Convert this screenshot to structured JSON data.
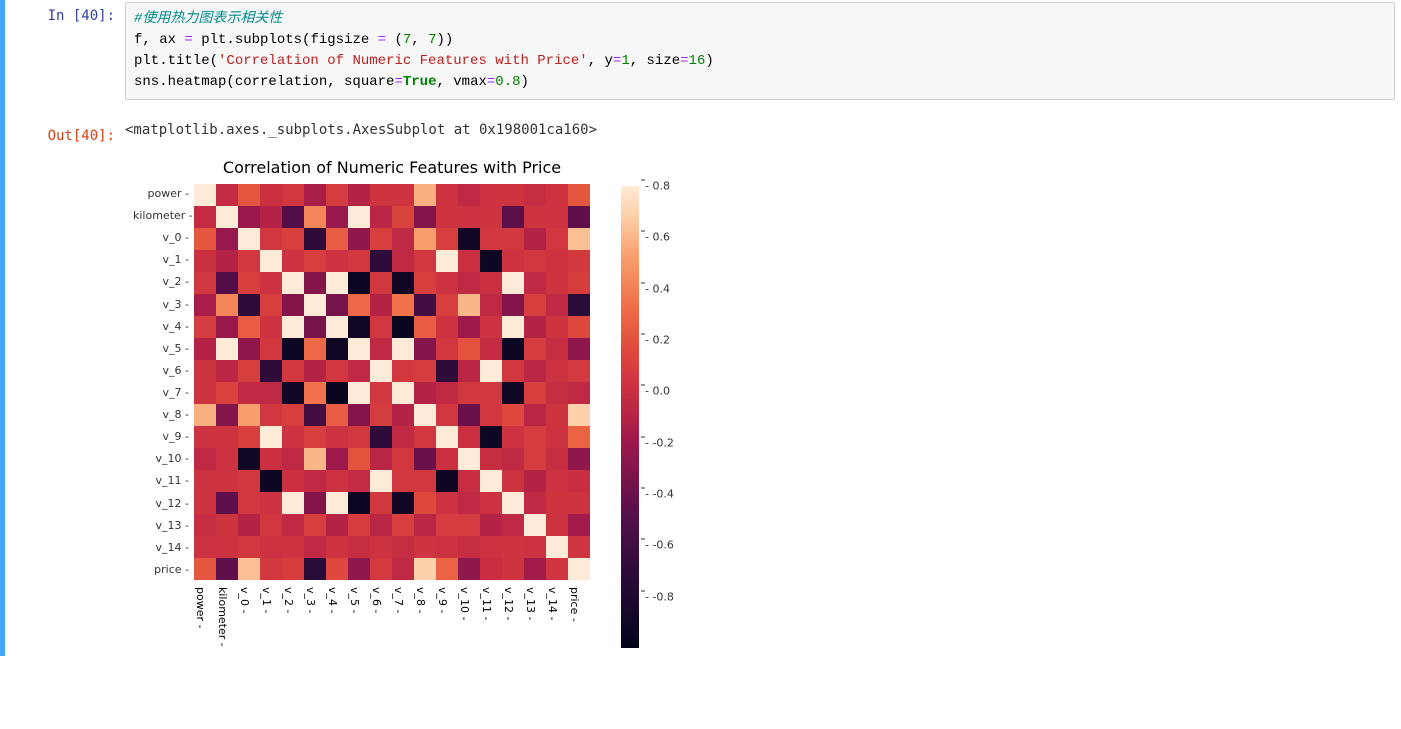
{
  "prompts": {
    "in_label": "In  [40]:",
    "out_label": "Out[40]:"
  },
  "code": {
    "line1_comment": "#使用热力图表示相关性",
    "line2_a": "f, ax ",
    "line2_eq": "=",
    "line2_b": " plt.subplots(figsize ",
    "line2_eq2": "=",
    "line2_c": " (",
    "line2_n1": "7",
    "line2_d": ", ",
    "line2_n2": "7",
    "line2_e": "))",
    "line3_a": "plt.title(",
    "line3_str": "'Correlation of Numeric Features with Price'",
    "line3_b": ", y",
    "line3_eq": "=",
    "line3_n1": "1",
    "line3_c": ", size",
    "line3_eq2": "=",
    "line3_n2": "16",
    "line3_d": ")",
    "line4_a": "sns.heatmap(correlation, square",
    "line4_eq": "=",
    "line4_true": "True",
    "line4_b": ", vmax",
    "line4_eq2": "=",
    "line4_n": "0.8",
    "line4_c": ")"
  },
  "output_text": "<matplotlib.axes._subplots.AxesSubplot at 0x198001ca160>",
  "chart_data": {
    "type": "heatmap",
    "title": "Correlation of Numeric Features with Price",
    "xlabel": "",
    "ylabel": "",
    "labels": [
      "power",
      "kilometer",
      "v_0",
      "v_1",
      "v_2",
      "v_3",
      "v_4",
      "v_5",
      "v_6",
      "v_7",
      "v_8",
      "v_9",
      "v_10",
      "v_11",
      "v_12",
      "v_13",
      "v_14",
      "price"
    ],
    "vmin": -1.0,
    "vmax": 0.8,
    "colorbar_ticks": [
      0.8,
      0.6,
      0.4,
      0.2,
      0.0,
      -0.2,
      -0.4,
      -0.6,
      -0.8
    ],
    "matrix": [
      [
        1.0,
        -0.03,
        0.22,
        0.01,
        0.05,
        -0.15,
        0.08,
        -0.1,
        0.03,
        0.03,
        0.58,
        0.02,
        -0.05,
        0.02,
        0.03,
        -0.02,
        0.02,
        0.22
      ],
      [
        -0.03,
        1.0,
        -0.22,
        -0.1,
        -0.5,
        0.42,
        -0.22,
        0.92,
        -0.07,
        0.12,
        -0.3,
        0.03,
        0.02,
        0.03,
        -0.45,
        0.03,
        0.02,
        -0.44
      ],
      [
        0.22,
        -0.22,
        1.0,
        0.05,
        0.1,
        -0.7,
        0.25,
        -0.25,
        0.1,
        -0.05,
        0.52,
        0.1,
        -0.9,
        0.05,
        0.05,
        -0.1,
        0.05,
        0.63
      ],
      [
        0.01,
        -0.1,
        0.05,
        1.0,
        0.02,
        0.1,
        0.02,
        0.05,
        -0.7,
        -0.05,
        0.05,
        0.9,
        0.01,
        -0.92,
        0.02,
        0.05,
        0.02,
        0.06
      ],
      [
        0.05,
        -0.5,
        0.1,
        0.02,
        1.0,
        -0.3,
        0.9,
        -0.92,
        0.05,
        -0.9,
        0.1,
        0.02,
        -0.05,
        0.01,
        0.95,
        -0.05,
        0.03,
        0.09
      ],
      [
        -0.15,
        0.42,
        -0.7,
        0.1,
        -0.3,
        1.0,
        -0.35,
        0.3,
        -0.1,
        0.35,
        -0.58,
        0.1,
        0.6,
        -0.05,
        -0.3,
        0.1,
        -0.05,
        -0.73
      ],
      [
        0.08,
        -0.22,
        0.25,
        0.02,
        0.9,
        -0.35,
        1.0,
        -0.9,
        0.05,
        -0.95,
        0.25,
        0.02,
        -0.2,
        0.02,
        0.92,
        -0.1,
        0.03,
        0.15
      ],
      [
        -0.1,
        0.92,
        -0.25,
        0.05,
        -0.92,
        0.3,
        -0.9,
        1.0,
        -0.05,
        0.9,
        -0.3,
        0.05,
        0.2,
        -0.03,
        -0.92,
        0.08,
        -0.02,
        -0.25
      ],
      [
        0.03,
        -0.07,
        0.1,
        -0.7,
        0.05,
        -0.1,
        0.05,
        -0.05,
        1.0,
        0.05,
        0.08,
        -0.7,
        -0.08,
        0.95,
        0.05,
        -0.08,
        0.02,
        0.07
      ],
      [
        0.03,
        0.12,
        -0.05,
        -0.05,
        -0.9,
        0.35,
        -0.95,
        0.9,
        0.05,
        1.0,
        -0.1,
        -0.05,
        0.05,
        0.05,
        -0.9,
        0.1,
        -0.02,
        -0.05
      ],
      [
        0.58,
        -0.3,
        0.52,
        0.05,
        0.1,
        -0.58,
        0.25,
        -0.3,
        0.08,
        -0.1,
        1.0,
        0.05,
        -0.4,
        0.05,
        0.15,
        -0.08,
        0.03,
        0.69
      ],
      [
        0.02,
        0.03,
        0.1,
        0.9,
        0.02,
        0.1,
        0.02,
        0.05,
        -0.7,
        -0.05,
        0.05,
        1.0,
        0.01,
        -0.92,
        0.02,
        0.08,
        0.02,
        0.28
      ],
      [
        -0.05,
        0.02,
        -0.9,
        0.01,
        -0.05,
        0.6,
        -0.2,
        0.2,
        -0.08,
        0.05,
        -0.4,
        0.01,
        1.0,
        -0.02,
        -0.05,
        0.08,
        -0.02,
        -0.25
      ],
      [
        0.02,
        0.03,
        0.05,
        -0.92,
        0.01,
        -0.05,
        0.02,
        -0.03,
        0.95,
        0.05,
        0.05,
        -0.92,
        -0.02,
        1.0,
        0.02,
        -0.1,
        0.02,
        -0.01
      ],
      [
        0.03,
        -0.45,
        0.05,
        0.02,
        0.95,
        -0.3,
        0.92,
        -0.92,
        0.05,
        -0.9,
        0.15,
        0.02,
        -0.05,
        0.02,
        1.0,
        -0.05,
        0.03,
        0.03
      ],
      [
        -0.02,
        0.03,
        -0.1,
        0.05,
        -0.05,
        0.1,
        -0.1,
        0.08,
        -0.08,
        0.1,
        -0.08,
        0.08,
        0.08,
        -0.1,
        -0.05,
        1.0,
        0.02,
        -0.18
      ],
      [
        0.02,
        0.02,
        0.05,
        0.02,
        0.03,
        -0.05,
        0.03,
        -0.02,
        0.02,
        -0.02,
        0.03,
        0.02,
        -0.02,
        0.02,
        0.03,
        0.02,
        1.0,
        0.04
      ],
      [
        0.22,
        -0.44,
        0.63,
        0.06,
        0.09,
        -0.73,
        0.15,
        -0.25,
        0.07,
        -0.05,
        0.69,
        0.28,
        -0.25,
        -0.01,
        0.03,
        -0.18,
        0.04,
        1.0
      ]
    ]
  }
}
